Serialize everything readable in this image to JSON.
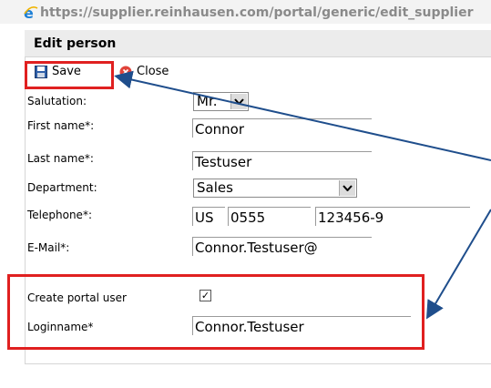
{
  "browser": {
    "url": "https://supplier.reinhausen.com/portal/generic/edit_supplier"
  },
  "dialog": {
    "title": "Edit person"
  },
  "toolbar": {
    "save_label": "Save",
    "close_label": "Close"
  },
  "form": {
    "salutation": {
      "label": "Salutation:",
      "value": "Mr."
    },
    "first_name": {
      "label": "First name*:",
      "value": "Connor"
    },
    "last_name": {
      "label": "Last name*:",
      "value": "Testuser"
    },
    "department": {
      "label": "Department:",
      "value": "Sales"
    },
    "telephone": {
      "label": "Telephone*:",
      "country": "US",
      "area": "0555",
      "number": "123456-9"
    },
    "email": {
      "label": "E-Mail*:",
      "value": "Connor.Testuser@"
    },
    "create_portal_user": {
      "label": "Create portal user",
      "checked": true
    },
    "loginname": {
      "label": "Loginname*",
      "value": "Connor.Testuser"
    }
  },
  "colors": {
    "highlight": "#e02020",
    "arrow": "#1f4e8c"
  },
  "icons": {
    "browser": "ie-icon",
    "save": "floppy-disk-icon",
    "close": "close-circle-icon"
  }
}
